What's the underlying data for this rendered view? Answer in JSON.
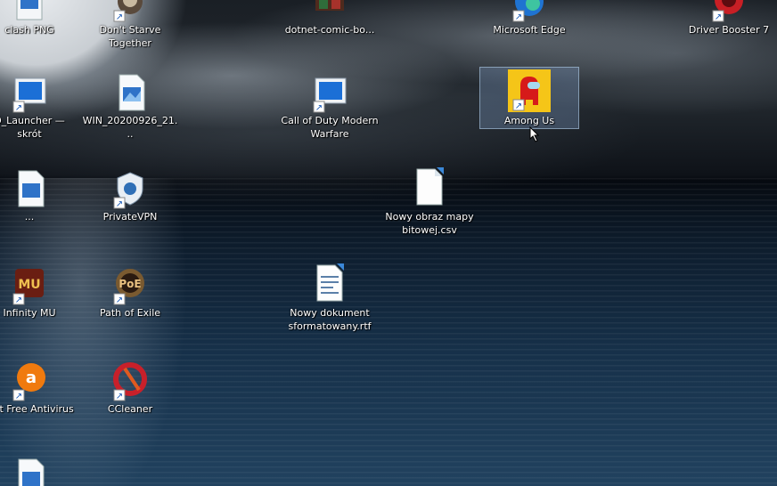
{
  "desktop": {
    "icons": [
      {
        "label": "clash PNG",
        "icon": "image-file-icon"
      },
      {
        "label": "Don't Starve Together",
        "icon": "dont-starve-icon"
      },
      {
        "label": "dotnet-comic-bo...",
        "icon": "comic-icon"
      },
      {
        "label": "Microsoft Edge",
        "icon": "edge-icon"
      },
      {
        "label": "Driver Booster 7",
        "icon": "driver-booster-icon"
      },
      {
        "label": "D_Launcher — skrót",
        "icon": "launcher-icon"
      },
      {
        "label": "WIN_20200926_21...",
        "icon": "image-file-icon"
      },
      {
        "label": "Call of Duty Modern Warfare",
        "icon": "cod-icon"
      },
      {
        "label": "Among Us",
        "icon": "among-us-icon"
      },
      {
        "label": "...",
        "icon": "image-file-icon"
      },
      {
        "label": "PrivateVPN",
        "icon": "privatevpn-icon"
      },
      {
        "label": "Nowy obraz mapy bitowej.csv",
        "icon": "csv-file-icon"
      },
      {
        "label": "Infinity MU",
        "icon": "infinity-mu-icon"
      },
      {
        "label": "Path of Exile",
        "icon": "path-of-exile-icon"
      },
      {
        "label": "Nowy dokument sformatowany.rtf",
        "icon": "rtf-file-icon"
      },
      {
        "label": "...st Free Antivirus",
        "icon": "avast-icon"
      },
      {
        "label": "CCleaner",
        "icon": "ccleaner-icon"
      }
    ]
  }
}
